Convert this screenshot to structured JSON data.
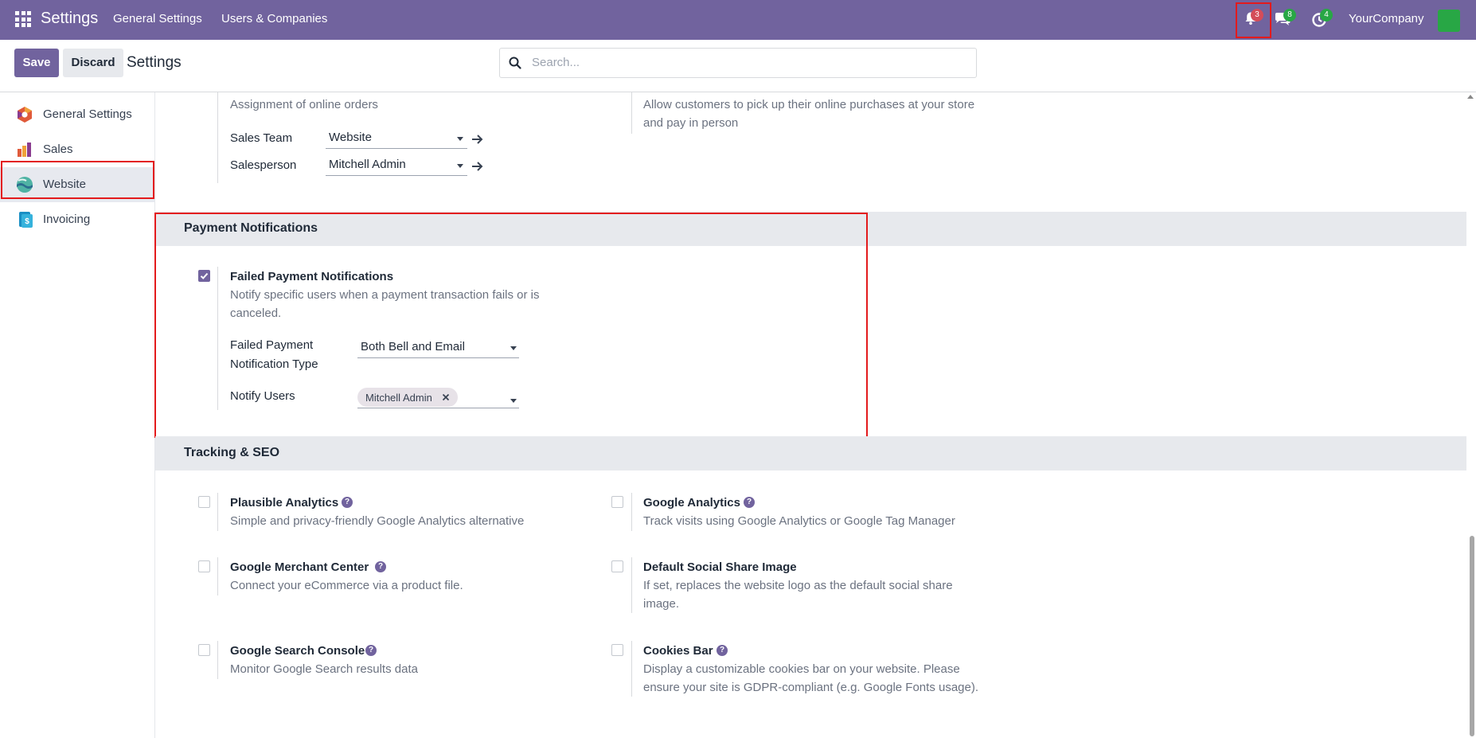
{
  "navbar": {
    "app_title": "Settings",
    "menu": [
      "General Settings",
      "Users & Companies"
    ],
    "notification_count": "3",
    "messages_count": "8",
    "activities_count": "4",
    "company": "YourCompany",
    "bg_color": "#71639e"
  },
  "control": {
    "save_label": "Save",
    "discard_label": "Discard",
    "title": "Settings",
    "search_placeholder": "Search..."
  },
  "sidebar": {
    "items": [
      {
        "label": "General Settings",
        "icon": "settings-app-icon"
      },
      {
        "label": "Sales",
        "icon": "sales-app-icon"
      },
      {
        "label": "Website",
        "icon": "website-app-icon",
        "active": true
      },
      {
        "label": "Invoicing",
        "icon": "invoicing-app-icon"
      }
    ]
  },
  "top_section": {
    "left_desc": "Assignment of online orders",
    "sales_team_label": "Sales Team",
    "sales_team_value": "Website",
    "salesperson_label": "Salesperson",
    "salesperson_value": "Mitchell Admin",
    "right_desc_line1": "Allow customers to pick up their online purchases at your store",
    "right_desc_line2": "and pay in person"
  },
  "payment_notifications": {
    "title": "Payment Notifications",
    "setting_title": "Failed Payment Notifications",
    "desc_line1": "Notify specific users when a payment transaction fails or is",
    "desc_line2": "canceled.",
    "checked": true,
    "type_label_line1": "Failed Payment",
    "type_label_line2": "Notification Type",
    "type_value": "Both Bell and Email",
    "users_label": "Notify Users",
    "users_tags": [
      "Mitchell Admin"
    ]
  },
  "tracking_seo": {
    "title": "Tracking & SEO",
    "settings": [
      {
        "title": "Plausible Analytics",
        "desc": [
          "Simple and privacy-friendly Google Analytics alternative"
        ],
        "checked": false
      },
      {
        "title": "Google Analytics",
        "desc": [
          "Track visits using Google Analytics or Google Tag Manager"
        ],
        "checked": false
      },
      {
        "title": "Google Merchant Center",
        "desc": [
          "Connect your eCommerce via a product file."
        ],
        "checked": false
      },
      {
        "title": "Default Social Share Image",
        "desc": [
          "If set, replaces the website logo as the default social share",
          "image."
        ],
        "checked": false
      },
      {
        "title": "Google Search Console",
        "desc": [
          "Monitor Google Search results data"
        ],
        "checked": false
      },
      {
        "title": "Cookies Bar",
        "desc": [
          "Display a customizable cookies bar on your website. Please",
          "ensure your site is GDPR-compliant (e.g. Google Fonts usage)."
        ],
        "checked": false
      }
    ]
  }
}
